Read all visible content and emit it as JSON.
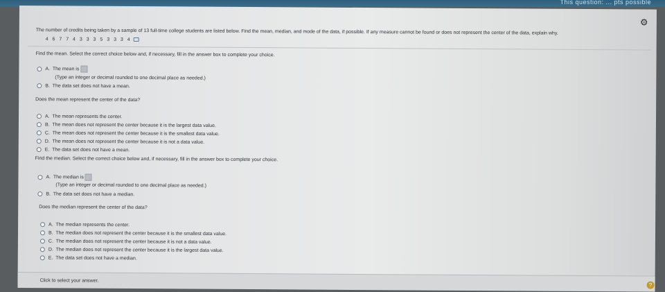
{
  "window": {
    "top_right_text": "This question: ... pts possible"
  },
  "question": {
    "prompt": "The number of credits being taken by a sample of 13 full-time college students are listed below. Find the mean, median, and mode of the data, if possible. If any measure cannot be found or does not represent the center of the data, explain why.",
    "data": "4 6 7 7 4 3 3 3 5 3 3 3 4"
  },
  "mean": {
    "instruction": "Find the mean. Select the correct choice below and, if necessary, fill in the answer box to complete your choice.",
    "choice_a_prefix": "A.",
    "choice_a_text": "The mean is",
    "choice_a_hint": "(Type an integer or decimal rounded to one decimal place as needed.)",
    "choice_b_prefix": "B.",
    "choice_b_text": "The data set does not have a mean."
  },
  "mean_center": {
    "question": "Does the mean represent the center of the data?",
    "options": [
      {
        "prefix": "A.",
        "text": "The mean represents the center."
      },
      {
        "prefix": "B.",
        "text": "The mean does not represent the center because it is the largest data value."
      },
      {
        "prefix": "C.",
        "text": "The mean does not represent the center because it is the smallest data value."
      },
      {
        "prefix": "D.",
        "text": "The mean does not represent the center because it is not a data value."
      },
      {
        "prefix": "E.",
        "text": "The data set does not have a mean."
      }
    ]
  },
  "median": {
    "instruction": "Find the median. Select the correct choice below and, if necessary, fill in the answer box to complete your choice.",
    "choice_a_prefix": "A.",
    "choice_a_text": "The median is",
    "choice_a_hint": "(Type an integer or decimal rounded to one decimal place as needed.)",
    "choice_b_prefix": "B.",
    "choice_b_text": "The data set does not have a median."
  },
  "median_center": {
    "question": "Does the median represent the center of the data?",
    "options": [
      {
        "prefix": "A.",
        "text": "The median represents the center."
      },
      {
        "prefix": "B.",
        "text": "The median does not represent the center because it is the smallest data value."
      },
      {
        "prefix": "C.",
        "text": "The median does not represent the center because it is not a data value."
      },
      {
        "prefix": "D.",
        "text": "The median does not represent the center because it is the largest data value."
      },
      {
        "prefix": "E.",
        "text": "The data set does not have a median."
      }
    ]
  },
  "footer": {
    "status": "Click to select your answer.",
    "help": "?"
  }
}
